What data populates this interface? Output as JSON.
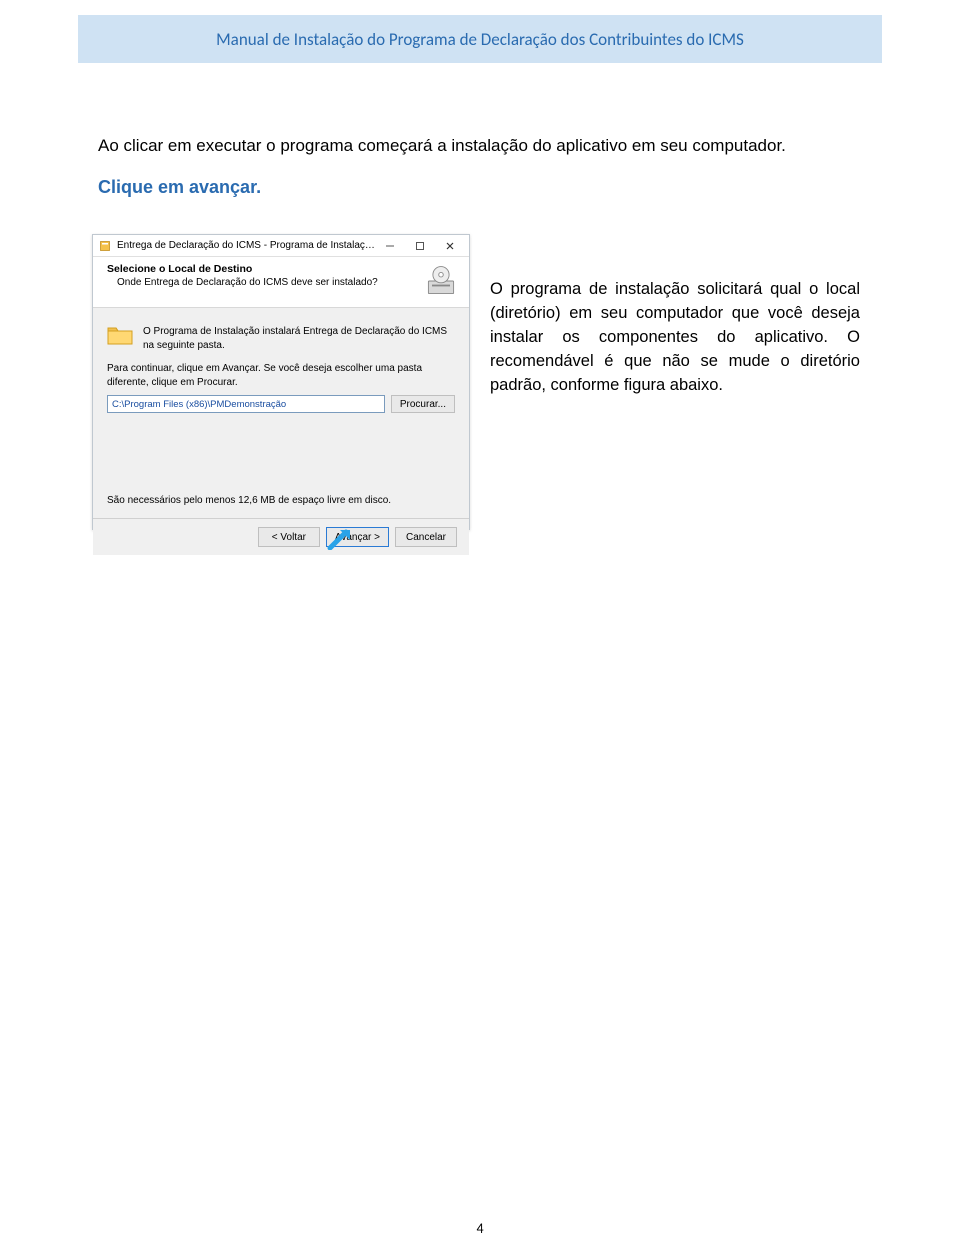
{
  "header": {
    "title": "Manual de Instalação do Programa de Declaração dos Contribuintes do ICMS"
  },
  "intro": {
    "line1": "Ao clicar em executar o programa começará a instalação do aplicativo em seu computador.",
    "line2": "Clique em avançar."
  },
  "sideParagraph": "O programa de instalação solicitará qual o local (diretório) em seu computador que você deseja instalar os componentes do aplicativo. O recomendável é que não se mude o diretório padrão, conforme figura abaixo.",
  "pageNumber": "4",
  "dialog": {
    "title": "Entrega de Declaração do ICMS - Programa de Instalação",
    "headTitle": "Selecione o Local de Destino",
    "headSub": "Onde Entrega de Declaração do ICMS deve ser instalado?",
    "folderText": "O Programa de Instalação instalará Entrega de Declaração do ICMS na seguinte pasta.",
    "bodyText": "Para continuar, clique em Avançar. Se você deseja escolher uma pasta diferente, clique em Procurar.",
    "pathValue": "C:\\Program Files (x86)\\PMDemonstração",
    "browseLabel": "Procurar...",
    "diskNote": "São necessários pelo menos 12,6 MB de espaço livre em disco.",
    "buttons": {
      "back": "< Voltar",
      "next": "Avançar >",
      "cancel": "Cancelar"
    }
  }
}
